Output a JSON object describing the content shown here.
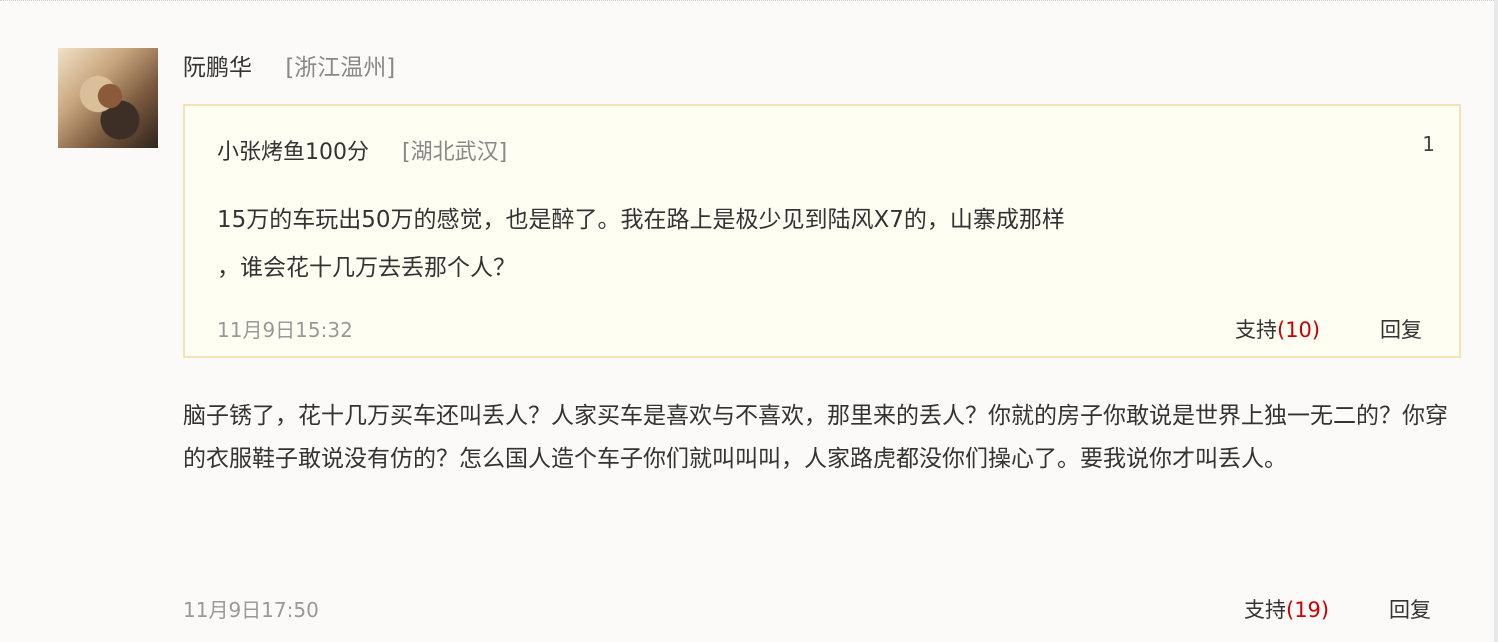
{
  "comment": {
    "user_name": "阮鹏华",
    "location": "[浙江温州]",
    "text": "脑子锈了，花十几万买车还叫丢人？人家买车是喜欢与不喜欢，那里来的丢人？你就的房子你敢说是世界上独一无二的？你穿的衣服鞋子敢说没有仿的？怎么国人造个车子你们就叫叫叫，人家路虎都没你们操心了。要我说你才叫丢人。",
    "time": "11月9日17:50",
    "support_label": "支持",
    "support_count": "(19)",
    "reply_label": "回复"
  },
  "quote": {
    "user_name": "小张烤鱼100分",
    "location": "[湖北武汉]",
    "floor": "1",
    "text_line1": "15万的车玩出50万的感觉，也是醉了。我在路上是极少见到陆风X7的，山寨成那样",
    "text_line2": "，谁会花十几万去丢那个人？",
    "time": "11月9日15:32",
    "support_label": "支持",
    "support_count": "(10)",
    "reply_label": "回复"
  }
}
